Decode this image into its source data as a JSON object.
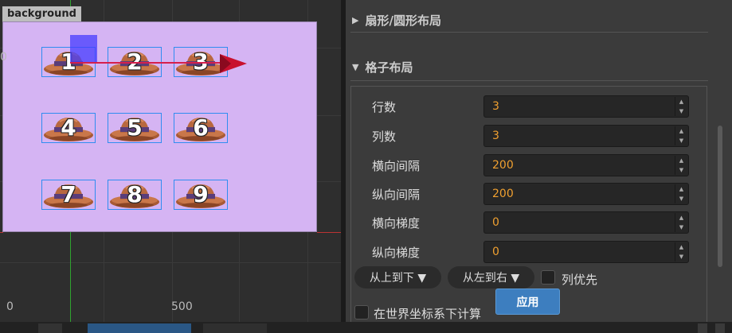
{
  "scene": {
    "node_name": "background",
    "ruler_x_labels": [
      "0",
      "500"
    ],
    "ruler_y_label": "0",
    "cells": [
      "1",
      "2",
      "3",
      "4",
      "5",
      "6",
      "7",
      "8",
      "9"
    ],
    "icon": "hat-icon",
    "colors": {
      "background_node": "#d5b4f3",
      "selection": "#2f8df0",
      "hat_body": "#b8683f",
      "hat_band": "#5a3d7a",
      "gizmo_x": "#d61f4c",
      "gizmo_y": "#2fa32f"
    }
  },
  "inspector": {
    "fan_section": "扇形/圆形布局",
    "grid_section": "格子布局",
    "fields": [
      {
        "label": "行数",
        "value": "3"
      },
      {
        "label": "列数",
        "value": "3"
      },
      {
        "label": "横向间隔",
        "value": "200"
      },
      {
        "label": "纵向间隔",
        "value": "200"
      },
      {
        "label": "横向梯度",
        "value": "0"
      },
      {
        "label": "纵向梯度",
        "value": "0"
      }
    ],
    "vertical_order": "从上到下 ▼",
    "horizontal_order": "从左到右 ▼",
    "column_first_label": "列优先",
    "world_coords_label": "在世界坐标系下计算",
    "apply_label": "应用"
  }
}
